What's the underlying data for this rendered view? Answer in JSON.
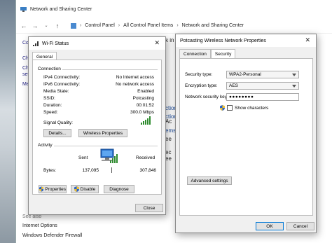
{
  "explorer": {
    "title": "Network and Sharing Center",
    "breadcrumb": [
      "Control Panel",
      "All Control Panel Items",
      "Network and Sharing Center"
    ],
    "left_links": [
      "Co",
      "Ch",
      "Ch",
      "set",
      "Me"
    ],
    "see_also": "See also",
    "bottom_links": [
      "Internet Options",
      "Windows Defender Firewall"
    ],
    "fragments": [
      "k in",
      "ction",
      "ction",
      "ems",
      "Ac",
      "ee",
      "ec",
      "ee"
    ]
  },
  "wifi_status": {
    "title": "Wi-Fi Status",
    "tab": "General",
    "connection_heading": "Connection",
    "rows": [
      {
        "label": "IPv4 Connectivity:",
        "value": "No Internet access"
      },
      {
        "label": "IPv6 Connectivity:",
        "value": "No network access"
      },
      {
        "label": "Media State:",
        "value": "Enabled"
      },
      {
        "label": "SSID:",
        "value": "Potcasting"
      },
      {
        "label": "Duration:",
        "value": "00:01:52"
      },
      {
        "label": "Speed:",
        "value": "300.0 Mbps"
      }
    ],
    "signal_label": "Signal Quality:",
    "details_button": "Details...",
    "wireless_properties_button": "Wireless Properties",
    "activity_heading": "Activity",
    "sent_label": "Sent",
    "received_label": "Received",
    "bytes_label": "Bytes:",
    "bytes_sent": "137,095",
    "bytes_received": "307,846",
    "properties_button": "Properties",
    "disable_button": "Disable",
    "diagnose_button": "Diagnose",
    "close_button": "Close"
  },
  "wireless_props": {
    "title": "Potcasting Wireless Network Properties",
    "tabs": [
      "Connection",
      "Security"
    ],
    "security_type_label": "Security type:",
    "security_type_value": "WPA2-Personal",
    "encryption_type_label": "Encryption type:",
    "encryption_type_value": "AES",
    "key_label": "Network security key",
    "key_value": "●●●●●●●●",
    "show_characters": "Show characters",
    "advanced_button": "Advanced settings",
    "ok_button": "OK",
    "cancel_button": "Cancel"
  }
}
